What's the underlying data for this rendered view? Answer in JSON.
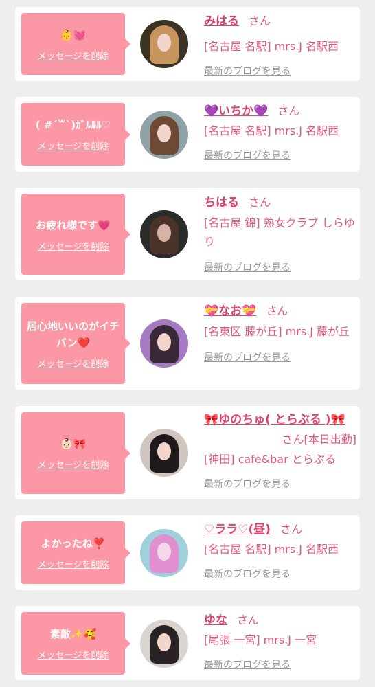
{
  "entries": [
    {
      "message": "👶💓",
      "delete_label": "メッセージを削除",
      "name": "みはる",
      "honorific": "さん",
      "shop": "[名古屋 名駅] mrs.J 名駅西",
      "blog_label": "最新のブログを見る"
    },
    {
      "message": "( #´꒳`)ｶﾞﾙﾙﾙ♡",
      "delete_label": "メッセージを削除",
      "name": "💜いちか💜",
      "honorific": "さん",
      "shop": "[名古屋 名駅] mrs.J 名駅西",
      "blog_label": "最新のブログを見る"
    },
    {
      "message": "お疲れ様です💗",
      "delete_label": "メッセージを削除",
      "name": "ちはる",
      "honorific": "さん",
      "shop": "[名古屋 錦] 熟女クラブ しらゆり",
      "blog_label": "最新のブログを見る"
    },
    {
      "message": "居心地いいのがイチバン❤️",
      "delete_label": "メッセージを削除",
      "name": "💝なお💝",
      "honorific": "さん",
      "shop": "[名東区 藤が丘] mrs.J 藤が丘",
      "blog_label": "最新のブログを見る"
    },
    {
      "message": "👶🏻🎀",
      "delete_label": "メッセージを削除",
      "name": "🎀ゆのちゅ( とらぶる )🎀",
      "honorific": "さん[本日出勤]",
      "shop": "[神田] cafe&bar とらぶる",
      "blog_label": "最新のブログを見る"
    },
    {
      "message": "よかったね❣️",
      "delete_label": "メッセージを削除",
      "name": "♡ララ♡(昼)",
      "honorific": "さん",
      "shop": "[名古屋 名駅] mrs.J 名駅西",
      "blog_label": "最新のブログを見る"
    },
    {
      "message": "素敵✨🥰",
      "delete_label": "メッセージを削除",
      "name": "ゆな",
      "honorific": "さん",
      "shop": "[尾張 一宮] mrs.J 一宮",
      "blog_label": "最新のブログを見る"
    }
  ],
  "colors": {
    "bubble": "#fc98a5",
    "name": "#d9456e",
    "shop_text": "#e0597a",
    "link_gray": "#999999",
    "page_bg": "#eeeeee"
  }
}
